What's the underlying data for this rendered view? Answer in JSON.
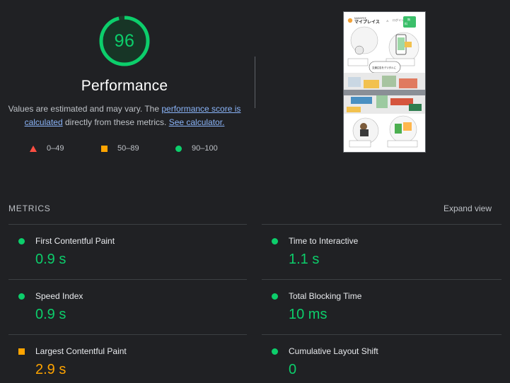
{
  "score": {
    "value": "96",
    "fraction": 0.96,
    "title": "Performance",
    "color": "#0cce6b"
  },
  "description": {
    "prefix": "Values are estimated and may vary. The ",
    "link1": "performance score is calculated",
    "middle": " directly from these metrics. ",
    "link2": "See calculator."
  },
  "legend": [
    {
      "range": "0–49",
      "shape": "triangle",
      "color": "#ff4e42"
    },
    {
      "range": "50–89",
      "shape": "square",
      "color": "#ffa400"
    },
    {
      "range": "90–100",
      "shape": "circle",
      "color": "#0cce6b"
    }
  ],
  "thumbnail": {
    "logo_text": "マイプレイス",
    "login_text": "ログイン",
    "banner_text": "交通広告をデジタルに"
  },
  "metrics": {
    "title": "METRICS",
    "expand_label": "Expand view",
    "items": [
      {
        "name": "First Contentful Paint",
        "value": "0.9 s",
        "status": "good"
      },
      {
        "name": "Time to Interactive",
        "value": "1.1 s",
        "status": "good"
      },
      {
        "name": "Speed Index",
        "value": "0.9 s",
        "status": "good"
      },
      {
        "name": "Total Blocking Time",
        "value": "10 ms",
        "status": "good"
      },
      {
        "name": "Largest Contentful Paint",
        "value": "2.9 s",
        "status": "average"
      },
      {
        "name": "Cumulative Layout Shift",
        "value": "0",
        "status": "good"
      }
    ]
  }
}
